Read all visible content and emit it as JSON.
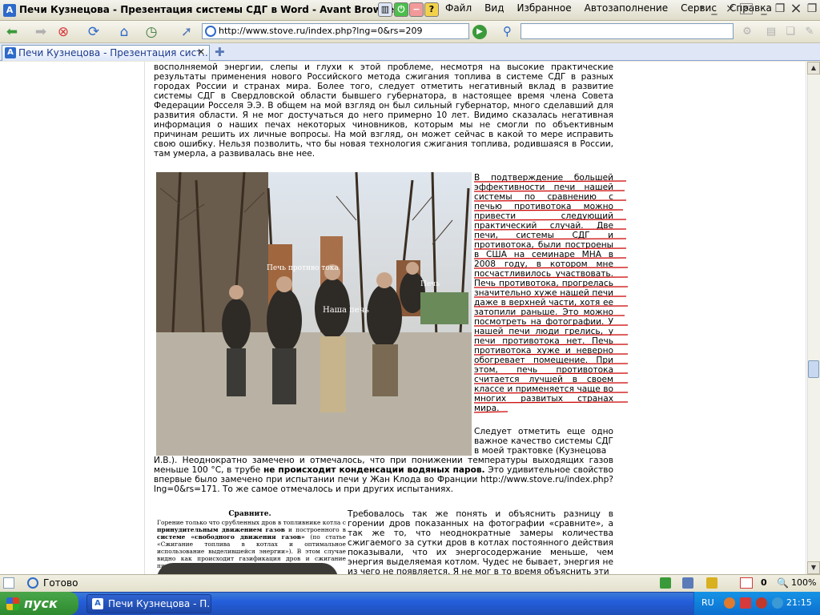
{
  "window": {
    "title": "Печи Кузнецова - Презентация системы СДГ в Word - Avant Browser",
    "app_icon": "avant-browser-icon"
  },
  "menu": [
    "Файл",
    "Вид",
    "Избранное",
    "Автозаполнение",
    "Сервис",
    "Справка"
  ],
  "address_bar": {
    "url": "http://www.stove.ru/index.php?lng=0&rs=209",
    "search_value": ""
  },
  "tabs": [
    {
      "label": "Печи Кузнецова - Презентация сист...",
      "active": true
    }
  ],
  "page": {
    "paragraph1": "восполняемой энергии, слепы и глухи к этой проблеме, несмотря на высокие практические результаты применения нового Российского метода сжигания топлива в системе СДГ в разных городах России и странах мира. Более того, следует отметить негативный вклад в развитие системы СДГ в Свердловской области бывшего губернатора, в настоящее время члена Совета Федерации Росселя Э.Э. В общем на мой взгляд он был сильный губернатор, много сделавший для развития области. Я не мог достучаться до него примерно 10 лет. Видимо сказалась негативная информация о наших печах некоторых чиновников, которым мы не смогли по объективным причинам решить их личные вопросы. На мой взгляд, он может сейчас в какой то мере исправить свою ошибку. Нельзя позволить, что бы новая технология сжигания топлива, родившаяся в России, там умерла, а развивалась вне нее.",
    "photo_labels": {
      "left": "Печь противо тока",
      "right": "Печь",
      "center": "Наша печь"
    },
    "paragraph2": "В подтверждение большей эффективности печи нашей системы по сравнению с печью противотока можно привести следующий практический случай. Две печи, системы СДГ и противотока, были построены в США на семинаре МНА в 2008 году, в котором мне посчастливилось участвовать. Печь противотока, прогрелась значительно хуже нашей печи даже в верхней части, хотя ее затопили раньше. Это можно посмотреть на фотографии. У нашей печи люди грелись, у печи противотока нет. Печь противотока хуже и неверно обогревает помещение. При этом, печь противотока считается лучшей в своем классе и применяется чаще во многих развитых странах мира.",
    "paragraph3": "Следует отметить еще одно важное качество системы СДГ в моей трактовке (Кузнецова",
    "paragraph4_a": "И.В.). Неоднократно замечено и отмечалось, что при понижении температуры выходящих газов меньше 100 °С, в трубе ",
    "paragraph4_bold": "не происходит конденсации водяных паров.",
    "paragraph4_b": " Это удивительное свойство впервые было замечено при испытании печи у Жан Клода во Франции http://www.stove.ru/index.php?lng=0&rs=171. То же самое отмечалось и при других испытаниях.",
    "inset": {
      "title": "Сравните.",
      "body_a": "Горение только что срубленных дров в топливнике котла с ",
      "body_bold1": "принудительным движением газов",
      "body_b": " и построенного в ",
      "body_bold2": "системе «свободного движения газов»",
      "body_c": " (по статье «Сжигание топлива в котлах и оптимальное использование выделившейся энергии»). В этом случае видно как происходит газификация дров и сжигание пиролизных газов, котел работает без дутья."
    },
    "paragraph5": "Требовалось так же понять и объяснить разницу в горении дров показанных на фотографии «сравните», а так же то, что неоднократные замеры количества сжигаемого за сутки дров в котлах постоянного действия показывали, что их энергосодержание меньше, чем энергия выделяемая котлом. Чудес не бывает, энергия не из чего не появляется. Я не мог в то время объяснить эти"
  },
  "status": {
    "text": "Готово",
    "count": "0",
    "zoom": "100%"
  },
  "taskbar": {
    "start_label": "пуск",
    "task_label": "Печи Кузнецова - П...",
    "lang": "RU",
    "clock": "21:15"
  },
  "colors": {
    "underline_red": "#cc0000",
    "start_green": "#2e8a2e",
    "taskbar_blue": "#245edb"
  }
}
